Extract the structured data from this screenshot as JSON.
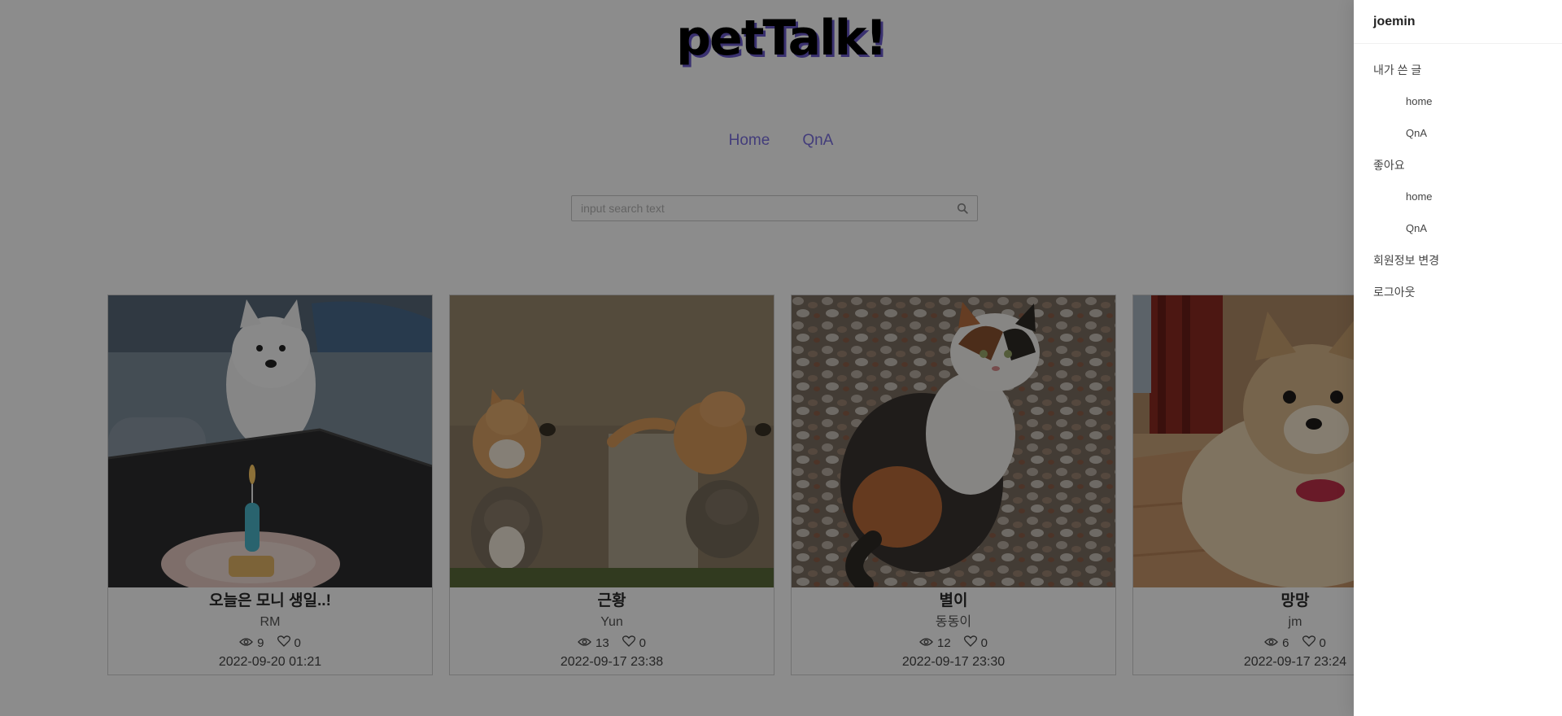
{
  "header": {
    "logo": "petTalk!"
  },
  "nav": {
    "items": [
      {
        "label": "Home"
      },
      {
        "label": "QnA"
      }
    ]
  },
  "search": {
    "placeholder": "input search text",
    "value": ""
  },
  "posts": [
    {
      "title": "오늘은 모니 생일..!",
      "author": "RM",
      "views": "9",
      "likes": "0",
      "date": "2022-09-20 01:21"
    },
    {
      "title": "근황",
      "author": "Yun",
      "views": "13",
      "likes": "0",
      "date": "2022-09-17 23:38"
    },
    {
      "title": "별이",
      "author": "동동이",
      "views": "12",
      "likes": "0",
      "date": "2022-09-17 23:30"
    },
    {
      "title": "망망",
      "author": "jm",
      "views": "6",
      "likes": "0",
      "date": "2022-09-17 23:24"
    }
  ],
  "drawer": {
    "username": "joemin",
    "menu": [
      {
        "label": "내가 쓴 글"
      },
      {
        "label": "home"
      },
      {
        "label": "QnA"
      },
      {
        "label": "좋아요"
      },
      {
        "label": "home"
      },
      {
        "label": "QnA"
      },
      {
        "label": "회원정보 변경"
      },
      {
        "label": "로그아웃"
      }
    ]
  },
  "colors": {
    "accent": "#7b6fe0",
    "logo_shadow": "#6a5acd",
    "overlay": "rgba(0,0,0,0.45)"
  }
}
